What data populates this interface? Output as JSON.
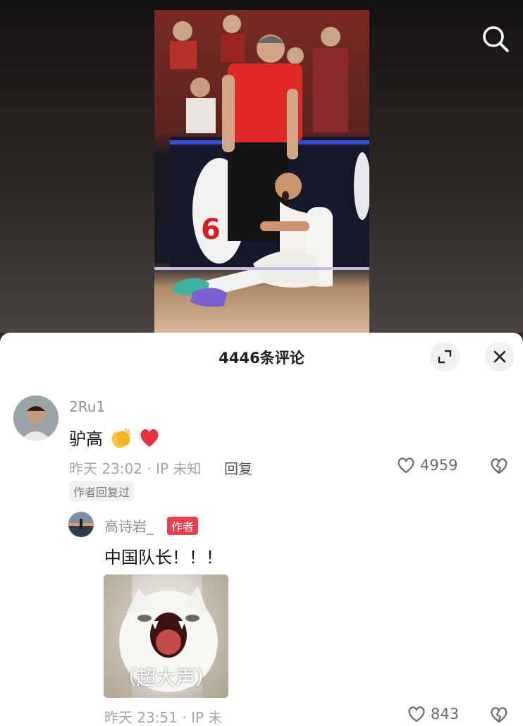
{
  "header": {
    "search_icon": "search-icon"
  },
  "comments_sheet": {
    "title": "4446条评论",
    "expand_icon": "expand-icon",
    "close_icon": "close-icon"
  },
  "comments": [
    {
      "username": "2Ru1",
      "text": "驴高",
      "emojis": [
        "clapping-hands-icon",
        "red-heart-icon"
      ],
      "time": "昨天 23:02 · IP 未知",
      "reply_label": "回复",
      "likes": "4959",
      "author_replied_tag": "作者回复过"
    }
  ],
  "reply": {
    "username": "高诗岩_",
    "author_badge": "作者",
    "text": "中国队长！！！",
    "sticker_caption": "（超大声）",
    "time": "昨天 23:51 · IP 未",
    "likes": "843"
  },
  "colors": {
    "badge_red": "#e8404f",
    "heart_red": "#e8303f",
    "muted_text": "#a3a3a8"
  }
}
